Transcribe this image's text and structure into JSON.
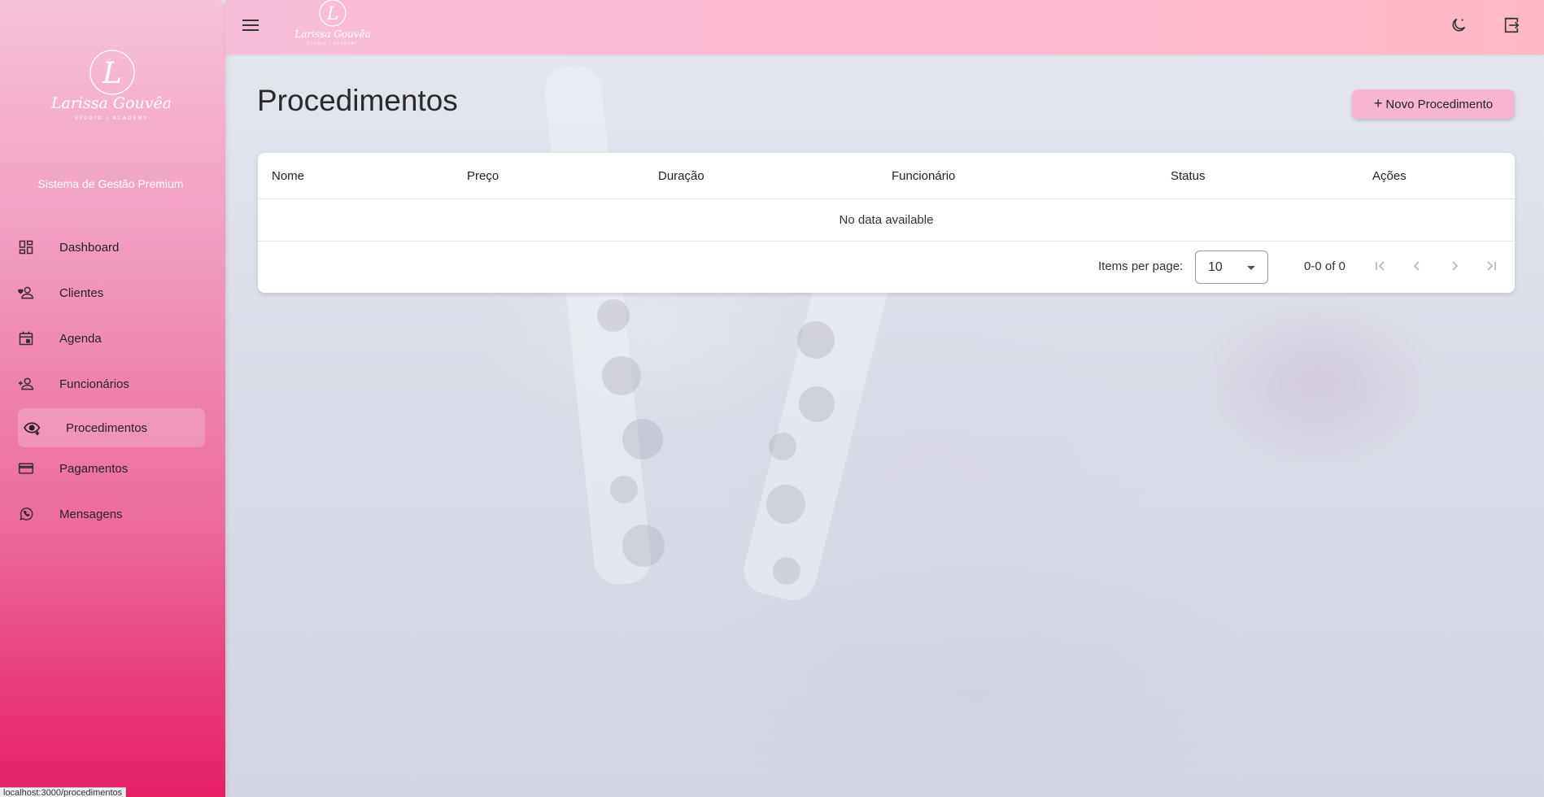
{
  "app": {
    "brand_name": "Larissa Gouvêa",
    "brand_sub": "STUDIO / ACADEMY",
    "tagline": "Sistema de Gestão Premium"
  },
  "sidebar": {
    "items": [
      {
        "label": "Dashboard",
        "icon": "dashboard-icon"
      },
      {
        "label": "Clientes",
        "icon": "person-heart-icon"
      },
      {
        "label": "Agenda",
        "icon": "calendar-icon"
      },
      {
        "label": "Funcionários",
        "icon": "person-add-icon"
      },
      {
        "label": "Procedimentos",
        "icon": "eye-plus-icon",
        "active": true
      },
      {
        "label": "Pagamentos",
        "icon": "credit-card-icon"
      },
      {
        "label": "Mensagens",
        "icon": "whatsapp-icon"
      }
    ]
  },
  "topbar": {
    "menu_icon": "menu-icon",
    "theme_icon": "moon-icon",
    "logout_icon": "logout-icon"
  },
  "main": {
    "title": "Procedimentos",
    "new_button_label": "Novo Procedimento",
    "table": {
      "columns": [
        "Nome",
        "Preço",
        "Duração",
        "Funcionário",
        "Status",
        "Ações"
      ],
      "empty_text": "No data available"
    },
    "paginator": {
      "items_per_page_label": "Items per page:",
      "page_size": "10",
      "range_label": "0-0 of 0"
    }
  },
  "statusbar": {
    "url": "localhost:3000/procedimentos"
  },
  "colors": {
    "sidebar_top": "#f6c3d9",
    "sidebar_bottom": "#e61f65",
    "topbar": "#fbbad0",
    "accent_button": "#f6b6cf"
  }
}
